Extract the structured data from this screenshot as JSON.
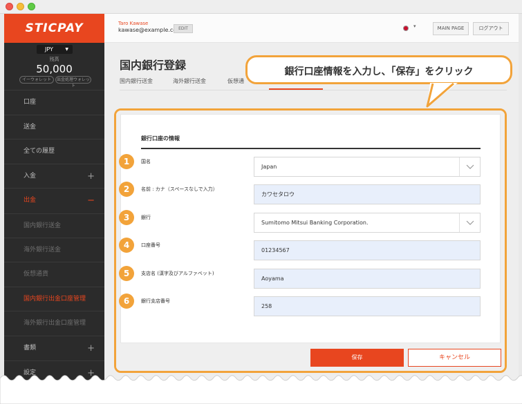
{
  "sidebar": {
    "logo": "STICPAY",
    "currency": "JPY",
    "balance_label": "残高",
    "balance_value": "50,000",
    "balance_buttons": [
      "イーウォレット",
      "出金処理ウォレット"
    ],
    "items": [
      {
        "label": "口座",
        "state": "normal"
      },
      {
        "label": "送金",
        "state": "normal"
      },
      {
        "label": "全ての履歴",
        "state": "normal"
      },
      {
        "label": "入金",
        "state": "normal",
        "expand": "+"
      },
      {
        "label": "出金",
        "state": "active",
        "expand": "−"
      },
      {
        "label": "国内銀行送金",
        "state": "sub"
      },
      {
        "label": "海外銀行送金",
        "state": "sub"
      },
      {
        "label": "仮想通貨",
        "state": "sub"
      },
      {
        "label": "国内銀行出金口座管理",
        "state": "active"
      },
      {
        "label": "海外銀行出金口座管理",
        "state": "sub"
      },
      {
        "label": "書類",
        "state": "normal",
        "expand": "+"
      },
      {
        "label": "設定",
        "state": "normal",
        "expand": "+"
      }
    ]
  },
  "header": {
    "user_name": "Taro Kawase",
    "user_email": "kawase@example.com",
    "edit_label": "EDIT",
    "main_page_label": "MAIN PAGE",
    "logout_label": "ログアウト"
  },
  "page": {
    "title": "国内銀行登録",
    "tabs": [
      "国内銀行送金",
      "海外銀行送金",
      "仮想通"
    ]
  },
  "callout": {
    "text": "銀行口座情報を入力し、「保存」をクリック"
  },
  "form": {
    "section_title": "銀行口座の情報",
    "fields": [
      {
        "num": "1",
        "label": "国名",
        "value": "Japan",
        "kind": "select"
      },
      {
        "num": "2",
        "label": "名前 : カナ（スペースなしで入力）",
        "value": "カワセタロウ",
        "kind": "input"
      },
      {
        "num": "3",
        "label": "銀行",
        "value": "Sumitomo Mitsui Banking Corporation.",
        "kind": "select"
      },
      {
        "num": "4",
        "label": "口座番号",
        "value": "01234567",
        "kind": "input"
      },
      {
        "num": "5",
        "label": "支店名 (漢字及びアルファベット)",
        "value": "Aoyama",
        "kind": "input"
      },
      {
        "num": "6",
        "label": "銀行支店番号",
        "value": "258",
        "kind": "input"
      }
    ],
    "save_label": "保存",
    "cancel_label": "キャンセル"
  },
  "colors": {
    "accent": "#e8461f",
    "highlight": "#f2a33a",
    "sidebar_bg": "#2b2b2b",
    "input_bg": "#e8effb"
  }
}
